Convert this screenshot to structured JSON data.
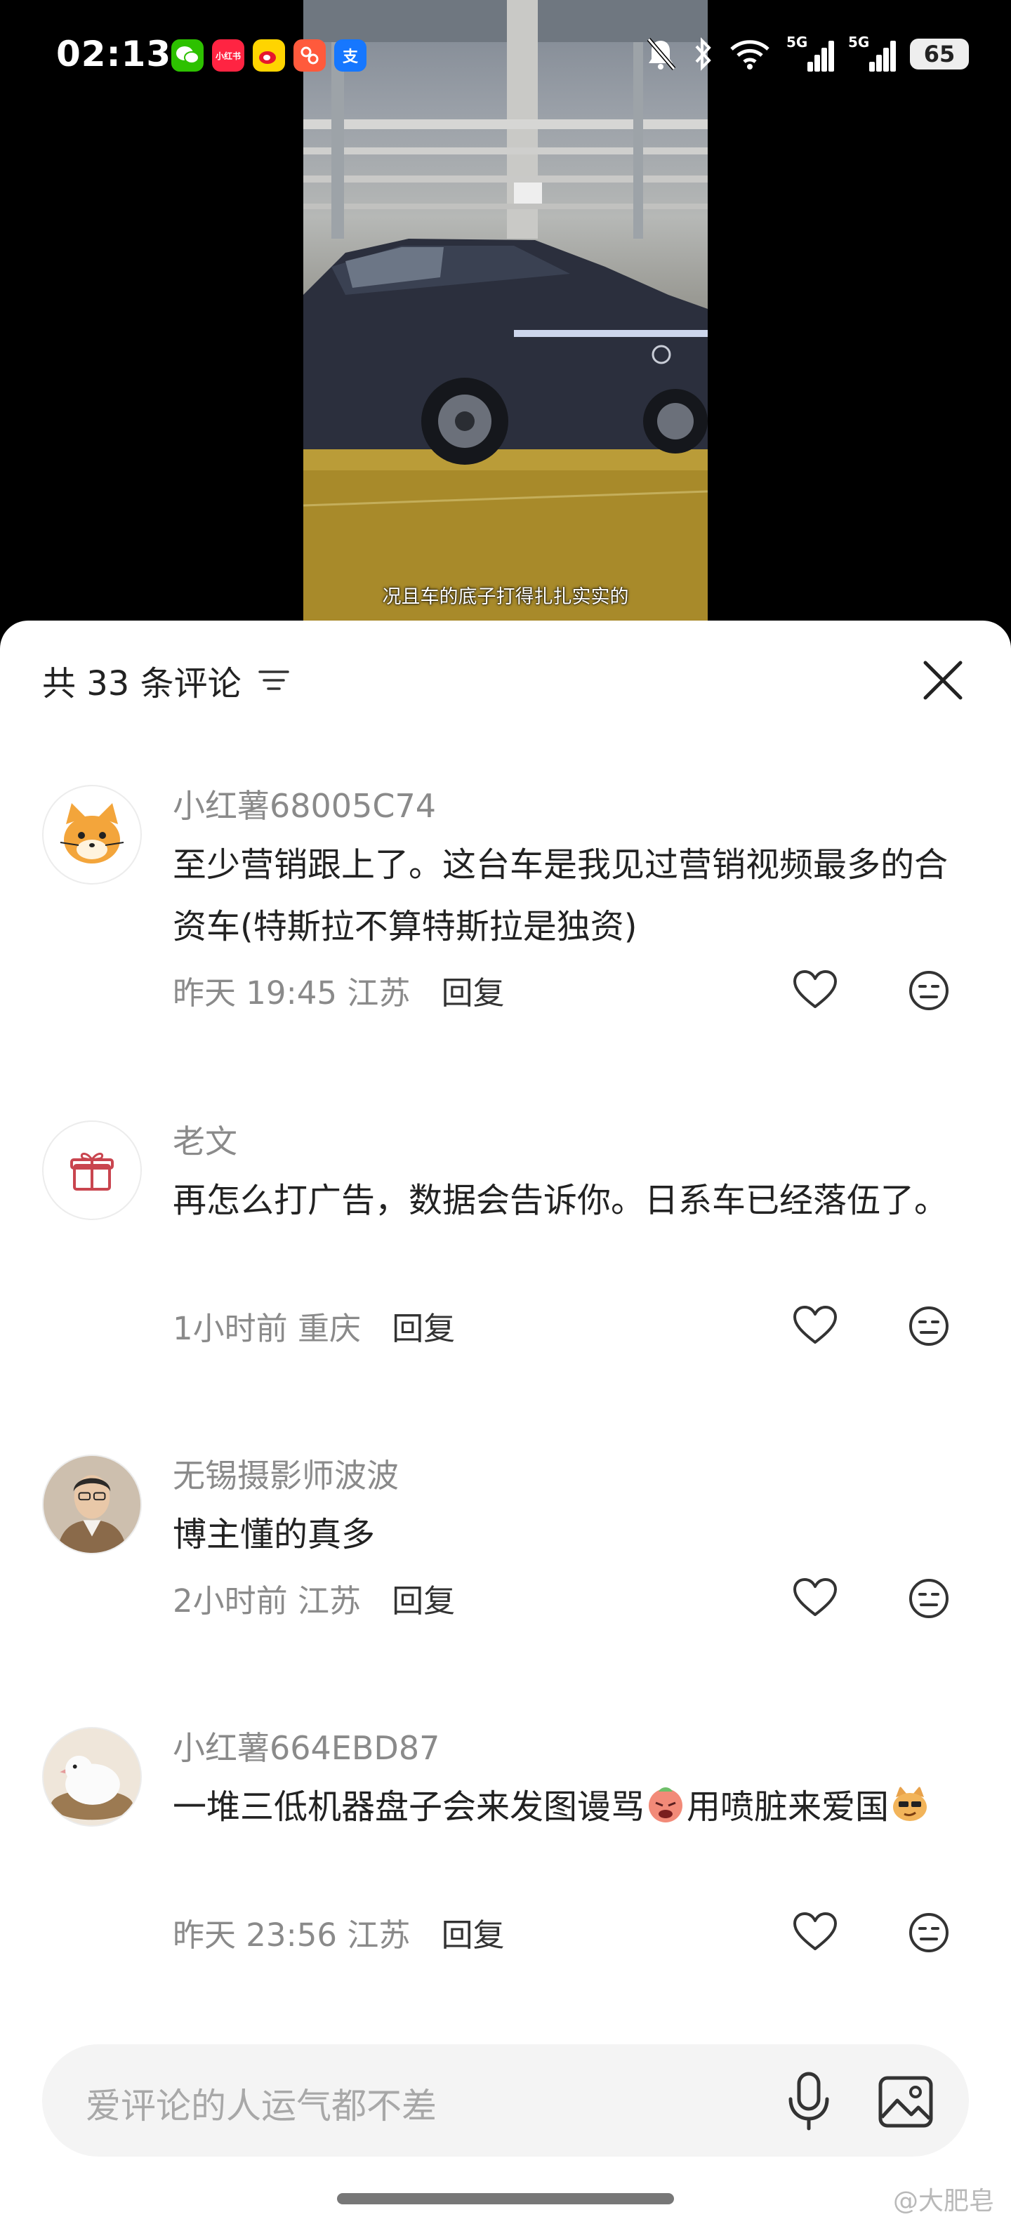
{
  "status_bar": {
    "time": "02:13",
    "app_icons": [
      "wechat-icon",
      "xiaohongshu-icon",
      "weibo-icon",
      "podcast-icon",
      "alipay-icon"
    ],
    "xiaohongshu_label": "小红书",
    "alipay_label": "支",
    "network_1": "5G",
    "network_2": "5G",
    "battery": "65"
  },
  "video": {
    "caption": "况且车的底子打得扎扎实实的"
  },
  "sheet": {
    "title": "共 33 条评论"
  },
  "comments": [
    {
      "username": "小红薯68005C74",
      "text": "至少营销跟上了。这台车是我见过营销视频最多的合资车(特斯拉不算特斯拉是独资)",
      "time": "昨天 19:45",
      "location": "江苏",
      "reply_label": "回复",
      "avatar": "cat-avatar"
    },
    {
      "username": "老文",
      "text": "再怎么打广告，数据会告诉你。日系车已经落伍了。",
      "time": "1小时前",
      "location": "重庆",
      "reply_label": "回复",
      "avatar": "gift-avatar"
    },
    {
      "username": "无锡摄影师波波",
      "text": "博主懂的真多",
      "time": "2小时前",
      "location": "江苏",
      "reply_label": "回复",
      "avatar": "person-avatar"
    },
    {
      "username": "小红薯664EBD87",
      "text_part1": "一堆三低机器盘子会来发图谩骂",
      "text_part2": "用喷脏来爱国",
      "time": "昨天 23:56",
      "location": "江苏",
      "reply_label": "回复",
      "avatar": "bird-avatar"
    }
  ],
  "input": {
    "placeholder": "爱评论的人运气都不差"
  },
  "watermark": "@大肥皂",
  "colors": {
    "text_primary": "#222222",
    "text_secondary": "#8a8a8a",
    "input_bg": "#f4f4f4"
  }
}
